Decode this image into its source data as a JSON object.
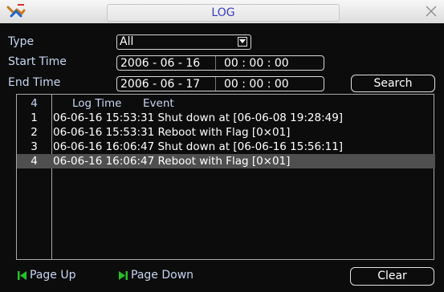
{
  "title": "LOG",
  "form": {
    "type_label": "Type",
    "type_value": "All",
    "start_label": "Start Time",
    "start_date": "2006  - 06 - 16",
    "start_time": "00 : 00 : 00",
    "end_label": "End Time",
    "end_date": "2006  - 06 - 17",
    "end_time": "00 : 00 : 00",
    "search_label": "Search"
  },
  "list": {
    "count": "4",
    "col_time": "Log Time",
    "col_event": "Event",
    "rows": [
      {
        "index": "1",
        "text": "06-06-16 15:53:31  Shut down at [06-06-08 19:28:49]"
      },
      {
        "index": "2",
        "text": "06-06-16 15:53:31  Reboot with Flag [0×01]"
      },
      {
        "index": "3",
        "text": "06-06-16 16:06:47  Shut down at [06-06-16 15:56:11]"
      },
      {
        "index": "4",
        "text": "06-06-16 16:06:47  Reboot with Flag [0×01]"
      }
    ],
    "selected_index": "4"
  },
  "footer": {
    "page_up": "Page Up",
    "page_down": "Page Down",
    "clear": "Clear"
  },
  "colors": {
    "title": "#3a3ac8",
    "label": "#c8d6f2",
    "page_icons": "#22c22a",
    "selected_row": "#4f4f4f"
  }
}
